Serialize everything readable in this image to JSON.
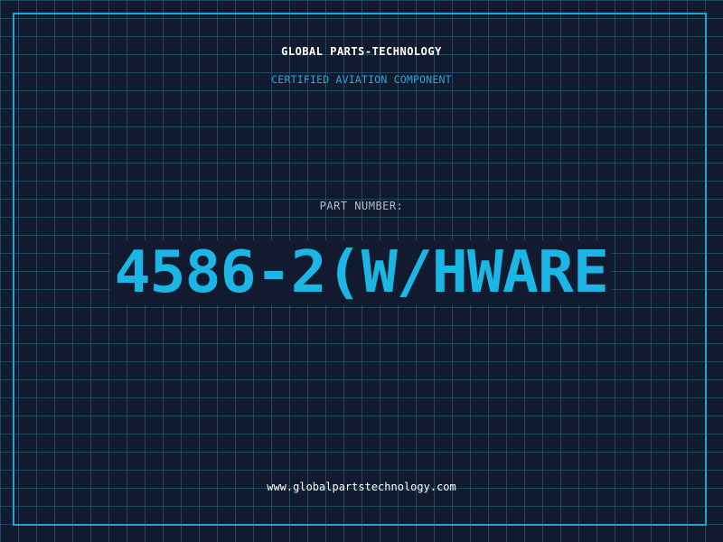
{
  "header": {
    "company_name": "GLOBAL PARTS-TECHNOLOGY",
    "subtitle": "CERTIFIED AVIATION COMPONENT"
  },
  "part": {
    "label": "PART NUMBER:",
    "number": "4586-2(W/HWARE"
  },
  "footer": {
    "website": "www.globalpartstechnology.com"
  },
  "colors": {
    "background": "#111a2e",
    "grid": "#286e8c",
    "frame": "#1fa3d0",
    "accent": "#1cb6e6",
    "subtitle": "#2aa6d8",
    "label": "#b4bcc8",
    "text": "#ffffff"
  }
}
